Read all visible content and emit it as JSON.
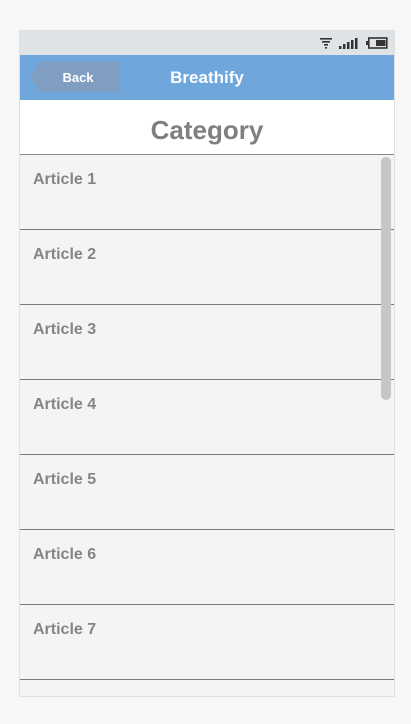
{
  "app": {
    "title": "Breathify",
    "back_label": "Back"
  },
  "page": {
    "title": "Category"
  },
  "articles": [
    {
      "label": "Article 1"
    },
    {
      "label": "Article 2"
    },
    {
      "label": "Article 3"
    },
    {
      "label": "Article 4"
    },
    {
      "label": "Article 5"
    },
    {
      "label": "Article 6"
    },
    {
      "label": "Article 7"
    },
    {
      "label": ""
    }
  ],
  "status_bar": {
    "icons": [
      "wifi-icon",
      "signal-icon",
      "battery-icon"
    ]
  },
  "colors": {
    "app_bar": "#6fa6dc",
    "back_button": "#7f9ec2",
    "status_bar": "#dfe3e6",
    "list_background": "#f4f4f4",
    "text_gray": "#858585"
  }
}
